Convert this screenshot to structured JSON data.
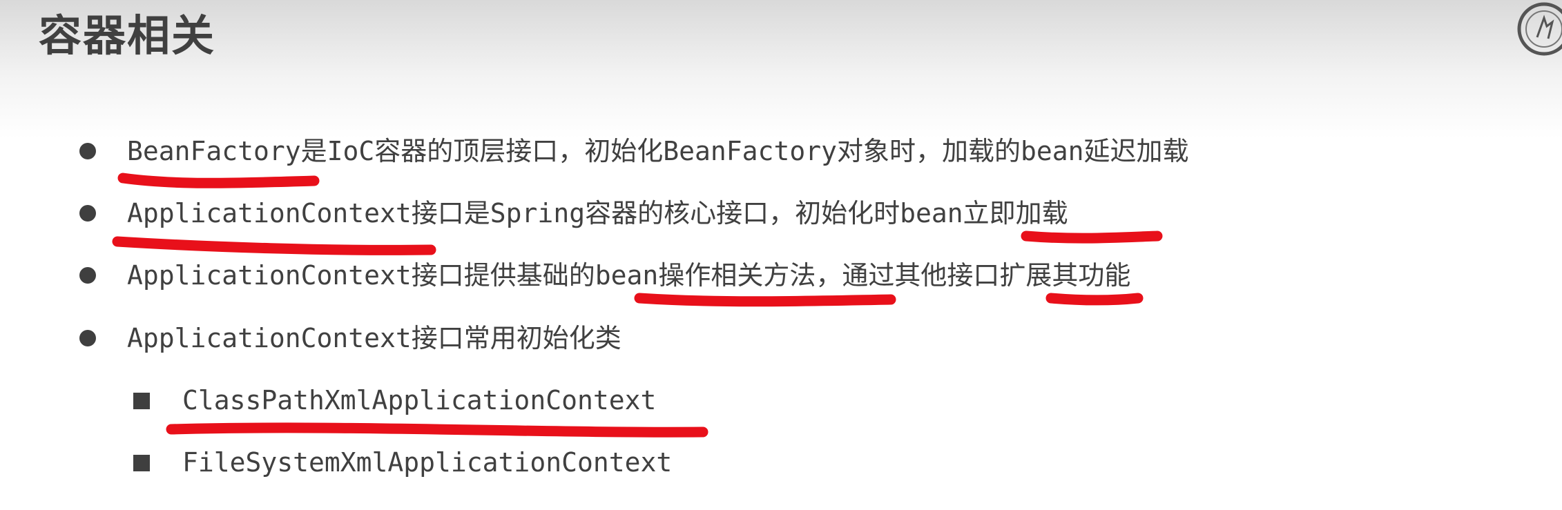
{
  "title": "容器相关",
  "bullets": [
    "BeanFactory是IoC容器的顶层接口，初始化BeanFactory对象时，加载的bean延迟加载",
    "ApplicationContext接口是Spring容器的核心接口，初始化时bean立即加载",
    "ApplicationContext接口提供基础的bean操作相关方法，通过其他接口扩展其功能",
    "ApplicationContext接口常用初始化类"
  ],
  "sub_bullets": [
    "ClassPathXmlApplicationContext",
    "FileSystemXmlApplicationContext"
  ],
  "colors": {
    "text": "#404040",
    "bullet": "#3f3f3f",
    "annotation": "#e8101a"
  }
}
